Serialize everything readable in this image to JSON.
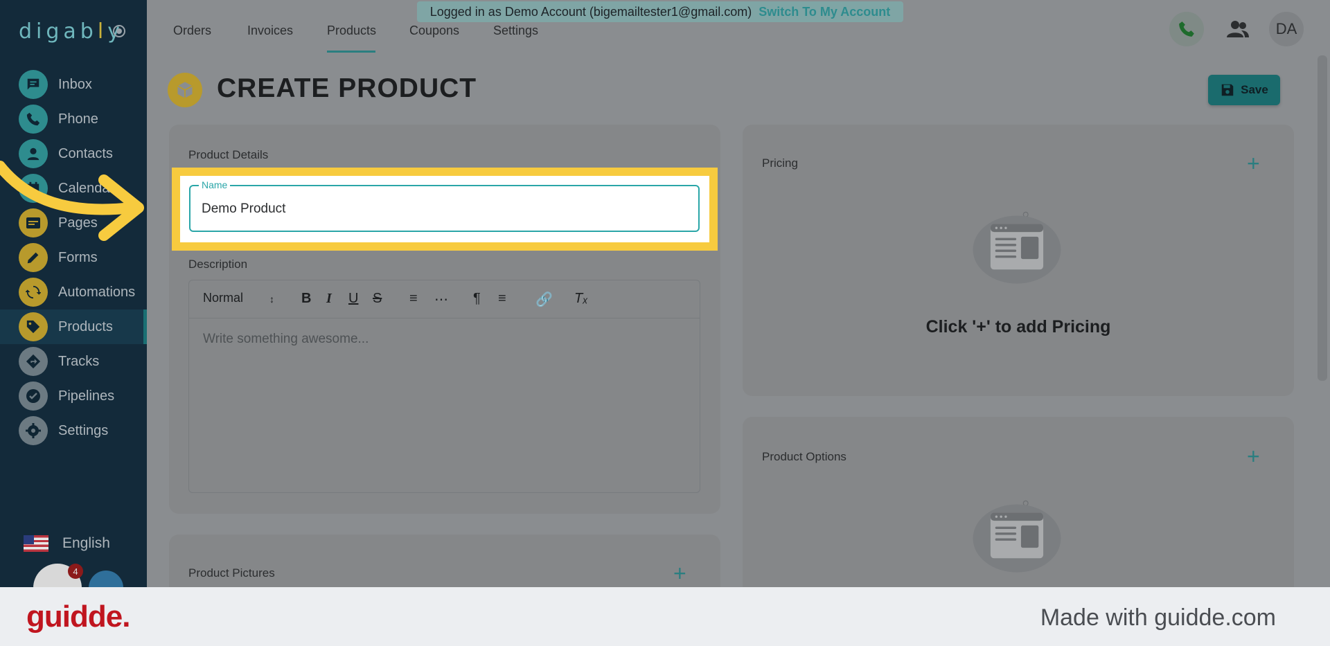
{
  "app": {
    "logo_text_a": "digab",
    "logo_text_b": "l",
    "logo_text_c": "y"
  },
  "sidebar": {
    "items": [
      {
        "label": "Inbox",
        "icon": "inbox-icon",
        "color": "#2e8c8e"
      },
      {
        "label": "Phone",
        "icon": "phone-icon",
        "color": "#2e8c8e"
      },
      {
        "label": "Contacts",
        "icon": "contact-icon",
        "color": "#2e8c8e"
      },
      {
        "label": "Calendar",
        "icon": "calendar-icon",
        "color": "#2e8c8e"
      },
      {
        "label": "Pages",
        "icon": "pages-icon",
        "color": "#b89a2c"
      },
      {
        "label": "Forms",
        "icon": "pencil-icon",
        "color": "#b89a2c"
      },
      {
        "label": "Automations",
        "icon": "automation-icon",
        "color": "#b89a2c"
      },
      {
        "label": "Products",
        "icon": "tag-icon",
        "color": "#b89a2c"
      },
      {
        "label": "Tracks",
        "icon": "tracks-icon",
        "color": "#6c7a82"
      },
      {
        "label": "Pipelines",
        "icon": "check-icon",
        "color": "#6c7a82"
      },
      {
        "label": "Settings",
        "icon": "gear-icon",
        "color": "#6c7a82"
      }
    ],
    "active": "Products",
    "language": "English",
    "notification_count": "4"
  },
  "topnav": {
    "tabs": [
      "Orders",
      "Invoices",
      "Products",
      "Coupons",
      "Settings"
    ],
    "active_tab": "Products",
    "banner_text": "Logged in as Demo Account (bigemailtester1@gmail.com)",
    "banner_link": "Switch To My Account",
    "user_initials": "DA"
  },
  "page": {
    "title": "CREATE PRODUCT",
    "save_label": "Save"
  },
  "product_details": {
    "section_title": "Product Details",
    "name_label": "Name",
    "name_value": "Demo Product",
    "description_label": "Description",
    "format_select": "Normal",
    "description_placeholder": "Write something awesome..."
  },
  "pricing": {
    "title": "Pricing",
    "empty_text": "Click '+' to add Pricing"
  },
  "product_options": {
    "title": "Product Options"
  },
  "product_pictures": {
    "title": "Product Pictures"
  },
  "footer": {
    "brand": "guidde.",
    "made_with": "Made with guidde.com"
  },
  "colors": {
    "accent": "#2aa6a8",
    "highlight": "#f7cb3f",
    "brand_red": "#c0151f"
  }
}
